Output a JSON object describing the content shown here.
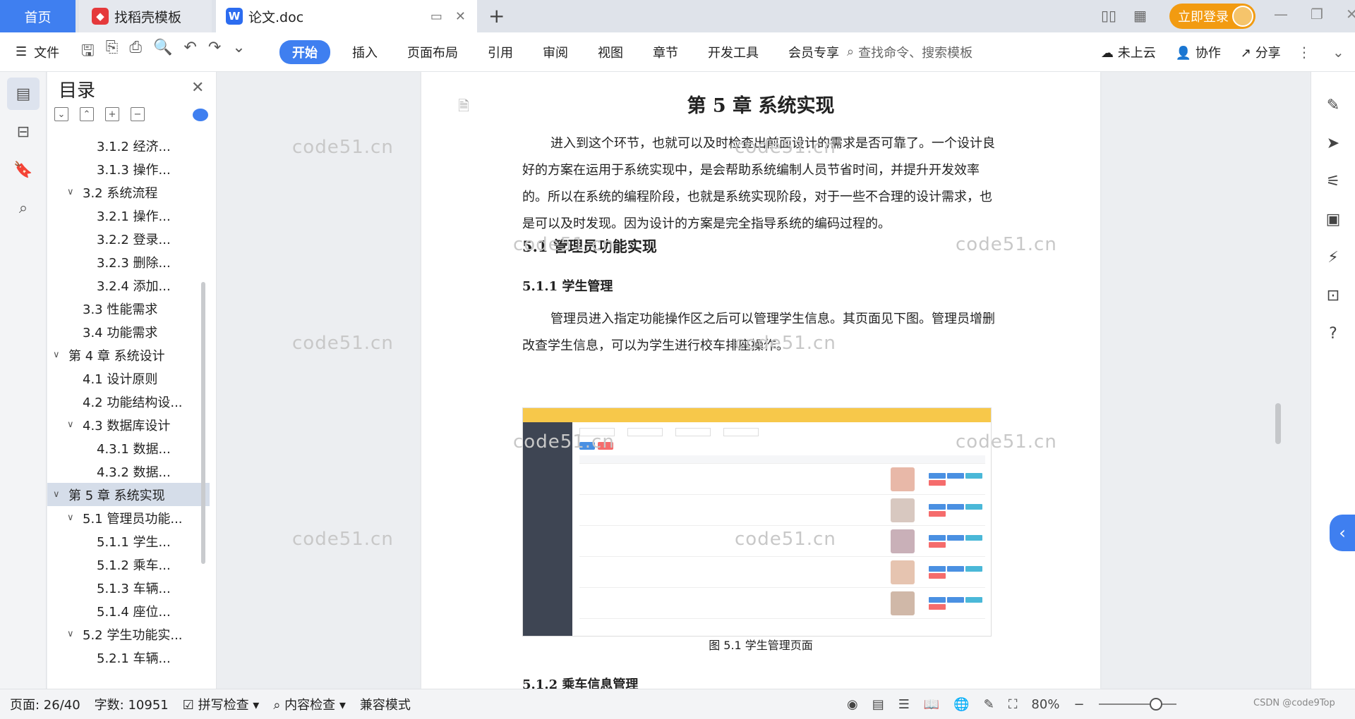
{
  "tabs": {
    "home": "首页",
    "template": "找稻壳模板",
    "doc": "论文.doc",
    "new_tab": "+"
  },
  "login_button": "立即登录",
  "toolbar": {
    "file_label": "文件",
    "ribbon": [
      "开始",
      "插入",
      "页面布局",
      "引用",
      "审阅",
      "视图",
      "章节",
      "开发工具",
      "会员专享"
    ],
    "search_placeholder": "查找命令、搜索模板",
    "cloud": "未上云",
    "collab": "协作",
    "share": "分享"
  },
  "toc": {
    "title": "目录",
    "items": [
      {
        "label": "3.1.2  经济...",
        "level": 3,
        "caret": ""
      },
      {
        "label": "3.1.3  操作...",
        "level": 3,
        "caret": ""
      },
      {
        "label": "3.2  系统流程",
        "level": 2,
        "caret": "v"
      },
      {
        "label": "3.2.1  操作...",
        "level": 3,
        "caret": ""
      },
      {
        "label": "3.2.2  登录...",
        "level": 3,
        "caret": ""
      },
      {
        "label": "3.2.3  删除...",
        "level": 3,
        "caret": ""
      },
      {
        "label": "3.2.4  添加...",
        "level": 3,
        "caret": ""
      },
      {
        "label": "3.3  性能需求",
        "level": 2,
        "caret": ""
      },
      {
        "label": "3.4  功能需求",
        "level": 2,
        "caret": ""
      },
      {
        "label": "第 4 章  系统设计",
        "level": 1,
        "caret": "v"
      },
      {
        "label": "4.1  设计原则",
        "level": 2,
        "caret": ""
      },
      {
        "label": "4.2  功能结构设...",
        "level": 2,
        "caret": ""
      },
      {
        "label": "4.3  数据库设计",
        "level": 2,
        "caret": "v"
      },
      {
        "label": "4.3.1  数据...",
        "level": 3,
        "caret": ""
      },
      {
        "label": "4.3.2  数据...",
        "level": 3,
        "caret": ""
      },
      {
        "label": "第 5 章  系统实现",
        "level": 1,
        "caret": "v",
        "selected": true
      },
      {
        "label": "5.1  管理员功能...",
        "level": 2,
        "caret": "v"
      },
      {
        "label": "5.1.1  学生...",
        "level": 3,
        "caret": ""
      },
      {
        "label": "5.1.2  乘车...",
        "level": 3,
        "caret": ""
      },
      {
        "label": "5.1.3  车辆...",
        "level": 3,
        "caret": ""
      },
      {
        "label": "5.1.4  座位...",
        "level": 3,
        "caret": ""
      },
      {
        "label": "5.2  学生功能实...",
        "level": 2,
        "caret": "v"
      },
      {
        "label": "5.2.1  车辆...",
        "level": 3,
        "caret": ""
      }
    ]
  },
  "document": {
    "chapter_title": "第 5 章  系统实现",
    "intro": "进入到这个环节，也就可以及时检查出前面设计的需求是否可靠了。一个设计良好的方案在运用于系统实现中，是会帮助系统编制人员节省时间，并提升开发效率的。所以在系统的编程阶段，也就是系统实现阶段，对于一些不合理的设计需求，也是可以及时发现。因为设计的方案是完全指导系统的编码过程的。",
    "section_5_1": "5.1  管理员功能实现",
    "section_5_1_1": "5.1.1  学生管理",
    "para_5_1_1": "管理员进入指定功能操作区之后可以管理学生信息。其页面见下图。管理员增删改查学生信息，可以为学生进行校车排座操作。",
    "figure_caption": "图 5.1  学生管理页面",
    "section_5_1_2": "5.1.2  乘车信息管理"
  },
  "watermark": "code51.cn",
  "status": {
    "page": "页面: 26/40",
    "words": "字数: 10951",
    "spell": "拼写检查",
    "content_check": "内容检查",
    "compat": "兼容模式",
    "zoom": "80%",
    "credit": "CSDN @code9Top"
  }
}
